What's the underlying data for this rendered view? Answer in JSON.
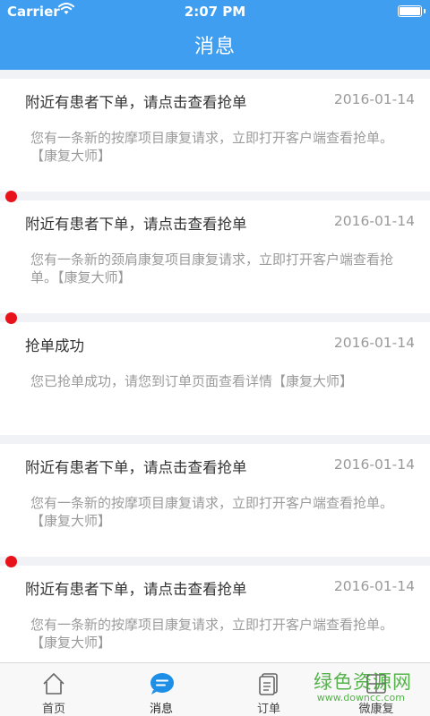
{
  "status_bar": {
    "carrier": "Carrier",
    "time": "2:07 PM"
  },
  "nav": {
    "title": "消息"
  },
  "messages": [
    {
      "title": "附近有患者下单，请点击查看抢单",
      "date": "2016-01-14",
      "body": "您有一条新的按摩项目康复请求，立即打开客户端查看抢单。【康复大师】",
      "unread": false
    },
    {
      "title": "附近有患者下单，请点击查看抢单",
      "date": "2016-01-14",
      "body": "您有一条新的颈肩康复项目康复请求，立即打开客户端查看抢单。【康复大师】",
      "unread": true
    },
    {
      "title": "抢单成功",
      "date": "2016-01-14",
      "body": "您已抢单成功，请您到订单页面查看详情【康复大师】",
      "unread": true
    },
    {
      "title": "附近有患者下单，请点击查看抢单",
      "date": "2016-01-14",
      "body": "您有一条新的按摩项目康复请求，立即打开客户端查看抢单。【康复大师】",
      "unread": false
    },
    {
      "title": "附近有患者下单，请点击查看抢单",
      "date": "2016-01-14",
      "body": "您有一条新的按摩项目康复请求，立即打开客户端查看抢单。【康复大师】",
      "unread": true
    }
  ],
  "tabbar": {
    "tabs": [
      {
        "label": "首页",
        "icon": "home-icon",
        "active": false
      },
      {
        "label": "消息",
        "icon": "chat-icon",
        "active": true
      },
      {
        "label": "订单",
        "icon": "document-icon",
        "active": false
      },
      {
        "label": "微康复",
        "icon": "grid-icon",
        "active": false
      }
    ]
  },
  "watermark": {
    "text": "绿色资源网",
    "sub": "www.downcc.com"
  },
  "colors": {
    "header": "#3f9ef0",
    "unread_dot": "#e8121b",
    "tab_active": "#1e8fe6",
    "tab_inactive": "#666666"
  }
}
